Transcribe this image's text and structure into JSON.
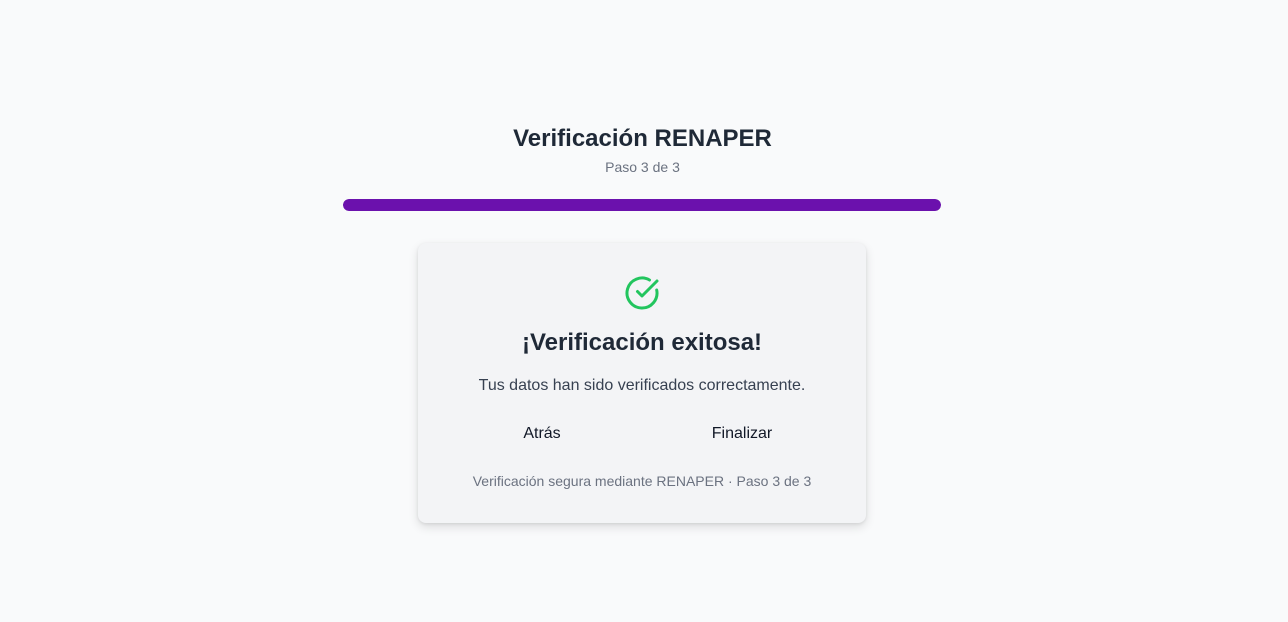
{
  "header": {
    "title": "Verificación RENAPER",
    "step": "Paso 3 de 3"
  },
  "progress": {
    "fraction": 1.0,
    "color": "#6b11ad"
  },
  "result": {
    "icon": "check-circle-icon",
    "icon_color": "#22c55e",
    "title": "¡Verificación exitosa!",
    "message": "Tus datos han sido verificados correctamente."
  },
  "actions": {
    "back_label": "Atrás",
    "finish_label": "Finalizar"
  },
  "footer": {
    "text": "Verificación segura mediante RENAPER · Paso 3 de 3"
  }
}
